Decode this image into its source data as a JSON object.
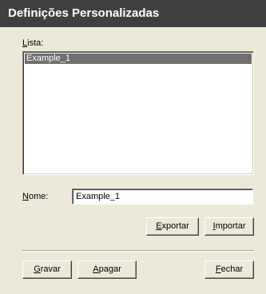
{
  "window": {
    "title": "Definições Personalizadas"
  },
  "list": {
    "label_key": "L",
    "label_rest": "ista:",
    "items": [
      "Example_1"
    ]
  },
  "name_field": {
    "label_key": "N",
    "label_rest": "ome:",
    "value": "Example_1"
  },
  "buttons": {
    "export": {
      "key": "E",
      "rest": "xportar"
    },
    "import": {
      "key": "I",
      "rest": "mportar"
    },
    "save": {
      "key": "G",
      "rest": "ravar"
    },
    "delete": {
      "key": "A",
      "rest": "pagar"
    },
    "close": {
      "key": "F",
      "rest": "echar"
    }
  }
}
